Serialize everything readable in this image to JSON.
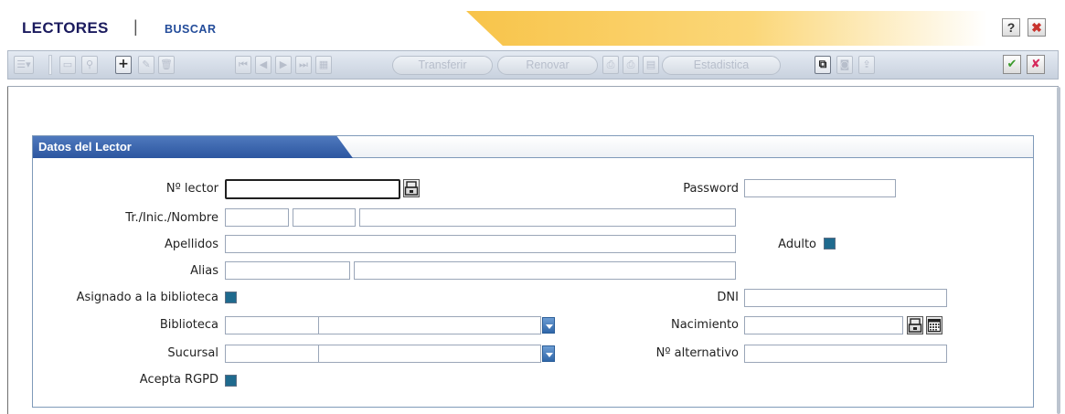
{
  "header": {
    "app_title": "LECTORES",
    "separator": "|",
    "subtitle": "BUSCAR",
    "help_label": "?",
    "close_label": "✖"
  },
  "toolbar": {
    "add_label": "+",
    "transferir_label": "Transferir",
    "renovar_label": "Renovar",
    "estadistica_label": "Estadistica",
    "confirm_label": "✔",
    "cancel_label": "✘"
  },
  "panel": {
    "title": "Datos del Lector"
  },
  "form": {
    "n_lector_label": "Nº lector",
    "n_lector_value": "",
    "password_label": "Password",
    "password_value": "",
    "nombre_label": "Tr./Inic./Nombre",
    "apellidos_label": "Apellidos",
    "adulto_label": "Adulto",
    "alias_label": "Alias",
    "asignado_label": "Asignado a la biblioteca",
    "dni_label": "DNI",
    "biblioteca_label": "Biblioteca",
    "nacimiento_label": "Nacimiento",
    "sucursal_label": "Sucursal",
    "n_alternativo_label": "Nº alternativo",
    "acepta_rgpd_label": "Acepta RGPD"
  },
  "colors": {
    "brand_navy": "#1b1b5e",
    "panel_blue": "#2c56a0",
    "title_gold": "#f8c44a",
    "checkbox_fill": "#1f6a8e"
  }
}
